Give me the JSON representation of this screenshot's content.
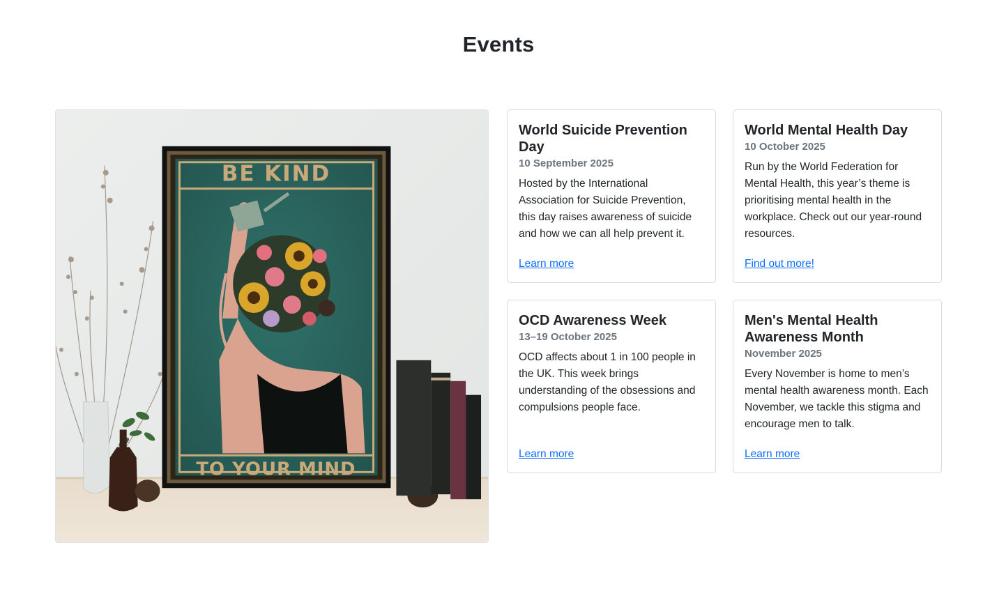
{
  "page": {
    "title": "Events"
  },
  "image": {
    "poster_top_text": "BE KIND",
    "poster_bottom_text": "TO YOUR MIND"
  },
  "events": [
    {
      "title": "World Suicide Prevention Day",
      "date": "10 September 2025",
      "description": "Hosted by the International Association for Suicide Prevention, this day raises awareness of suicide and how we can all help prevent it.",
      "link": "Learn more"
    },
    {
      "title": "World Mental Health Day",
      "date": "10 October 2025",
      "description": "Run by the World Federation for Mental Health, this year’s theme is prioritising mental health in the workplace. Check out our year-round resources.",
      "link": "Find out more!"
    },
    {
      "title": "OCD Awareness Week",
      "date": "13–19 October 2025",
      "description": "OCD affects about 1 in 100 people in the UK. This week brings understanding of the obsessions and compulsions people face.",
      "link": "Learn more"
    },
    {
      "title": "Men's Mental Health Awareness Month",
      "date": "November 2025",
      "description": "Every November is home to men’s mental health awareness month. Each November, we tackle this stigma and encourage men to talk.",
      "link": "Learn more"
    }
  ],
  "colors": {
    "link": "#0d6efd",
    "muted": "#6c757d",
    "poster_teal": "#2c6a64",
    "poster_gold": "#c9a97a"
  }
}
